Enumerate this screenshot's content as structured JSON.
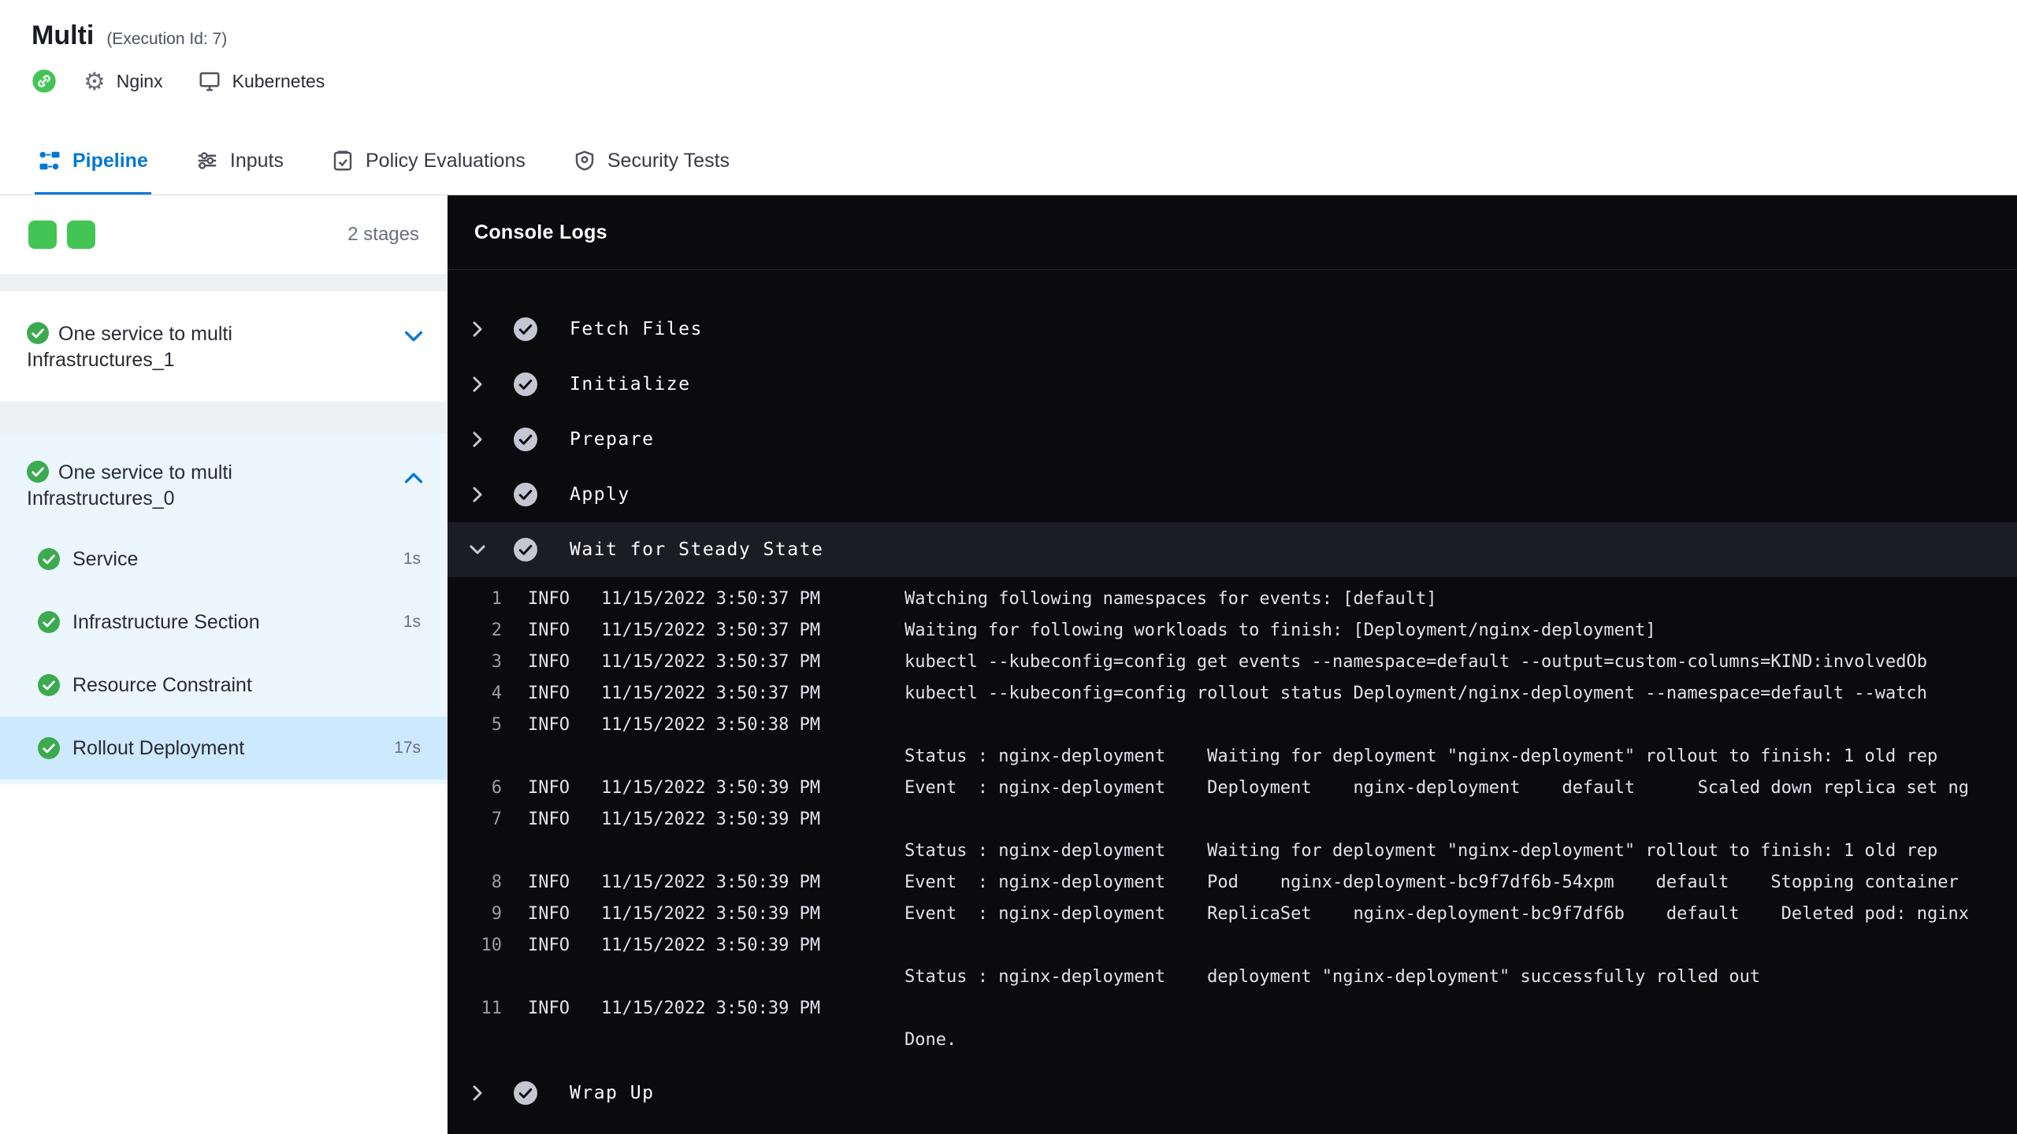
{
  "header": {
    "title": "Multi",
    "execution_id": "(Execution Id: 7)",
    "service_label": "Nginx",
    "infra_label": "Kubernetes"
  },
  "tabs": {
    "pipeline": "Pipeline",
    "inputs": "Inputs",
    "policy": "Policy Evaluations",
    "security": "Security Tests"
  },
  "sidebar": {
    "stage_count": "2 stages",
    "stage1": {
      "title": "One service to multi Infrastructures_1"
    },
    "stage2": {
      "title": "One service to multi Infrastructures_0",
      "steps": [
        {
          "label": "Service",
          "duration": "1s"
        },
        {
          "label": "Infrastructure Section",
          "duration": "1s"
        },
        {
          "label": "Resource Constraint",
          "duration": ""
        },
        {
          "label": "Rollout Deployment",
          "duration": "17s"
        }
      ]
    }
  },
  "console": {
    "title": "Console Logs",
    "steps": [
      "Fetch Files",
      "Initialize",
      "Prepare",
      "Apply",
      "Wait for Steady State",
      "Wrap Up"
    ],
    "logs": [
      {
        "n": "1",
        "level": "INFO",
        "time": "11/15/2022 3:50:37 PM",
        "msg": "Watching following namespaces for events: [default]"
      },
      {
        "n": "2",
        "level": "INFO",
        "time": "11/15/2022 3:50:37 PM",
        "msg": "Waiting for following workloads to finish: [Deployment/nginx-deployment]"
      },
      {
        "n": "3",
        "level": "INFO",
        "time": "11/15/2022 3:50:37 PM",
        "msg": "kubectl --kubeconfig=config get events --namespace=default --output=custom-columns=KIND:involvedOb"
      },
      {
        "n": "4",
        "level": "INFO",
        "time": "11/15/2022 3:50:37 PM",
        "msg": "kubectl --kubeconfig=config rollout status Deployment/nginx-deployment --namespace=default --watch"
      },
      {
        "n": "5",
        "level": "INFO",
        "time": "11/15/2022 3:50:38 PM",
        "msg": "\nStatus : nginx-deployment    Waiting for deployment \"nginx-deployment\" rollout to finish: 1 old rep"
      },
      {
        "n": "6",
        "level": "INFO",
        "time": "11/15/2022 3:50:39 PM",
        "msg": "Event  : nginx-deployment    Deployment    nginx-deployment    default      Scaled down replica set ng"
      },
      {
        "n": "7",
        "level": "INFO",
        "time": "11/15/2022 3:50:39 PM",
        "msg": "\nStatus : nginx-deployment    Waiting for deployment \"nginx-deployment\" rollout to finish: 1 old rep"
      },
      {
        "n": "8",
        "level": "INFO",
        "time": "11/15/2022 3:50:39 PM",
        "msg": "Event  : nginx-deployment    Pod    nginx-deployment-bc9f7df6b-54xpm    default    Stopping container"
      },
      {
        "n": "9",
        "level": "INFO",
        "time": "11/15/2022 3:50:39 PM",
        "msg": "Event  : nginx-deployment    ReplicaSet    nginx-deployment-bc9f7df6b    default    Deleted pod: nginx"
      },
      {
        "n": "10",
        "level": "INFO",
        "time": "11/15/2022 3:50:39 PM",
        "msg": "\nStatus : nginx-deployment    deployment \"nginx-deployment\" successfully rolled out"
      },
      {
        "n": "11",
        "level": "INFO",
        "time": "11/15/2022 3:50:39 PM",
        "msg": "\nDone."
      }
    ]
  },
  "colors": {
    "accent": "#0278d5",
    "success": "#3cab4f",
    "success-bright": "#42c554",
    "console-bg": "#0b0b0e",
    "selected-step-bg": "#cde9fd",
    "expanded-stage-bg": "#ebf6ff"
  }
}
